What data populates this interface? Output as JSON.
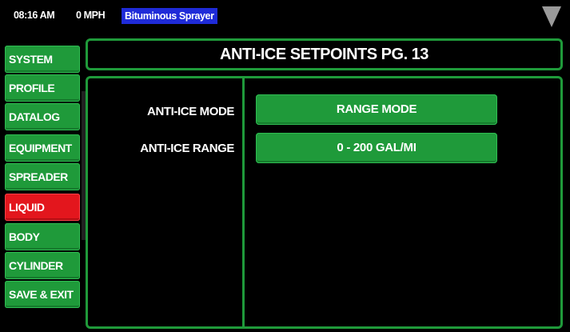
{
  "status_bar": {
    "time": "08:16 AM",
    "speed": "0 MPH",
    "mode": "Bituminous Sprayer",
    "menu_icon": "triangle-down-icon"
  },
  "sidebar": {
    "items": [
      {
        "label": "SYSTEM",
        "active": false
      },
      {
        "label": "PROFILE",
        "active": false
      },
      {
        "label": "DATALOG",
        "active": false
      },
      {
        "label": "EQUIPMENT",
        "active": false
      },
      {
        "label": "SPREADER",
        "active": false
      },
      {
        "label": "LIQUID",
        "active": true
      },
      {
        "label": "BODY",
        "active": false
      },
      {
        "label": "CYLINDER",
        "active": false
      },
      {
        "label": "SAVE & EXIT",
        "active": false
      }
    ]
  },
  "page": {
    "title": "ANTI-ICE SETPOINTS PG. 13"
  },
  "settings": {
    "mode_label": "ANTI-ICE MODE",
    "mode_value": "RANGE MODE",
    "range_label": "ANTI-ICE RANGE",
    "range_value": "0 - 200 GAL/MI"
  },
  "colors": {
    "accent_green": "#1f9a3a",
    "active_red": "#e3161d",
    "mode_badge_blue": "#1f2bd8",
    "background": "#000000"
  }
}
